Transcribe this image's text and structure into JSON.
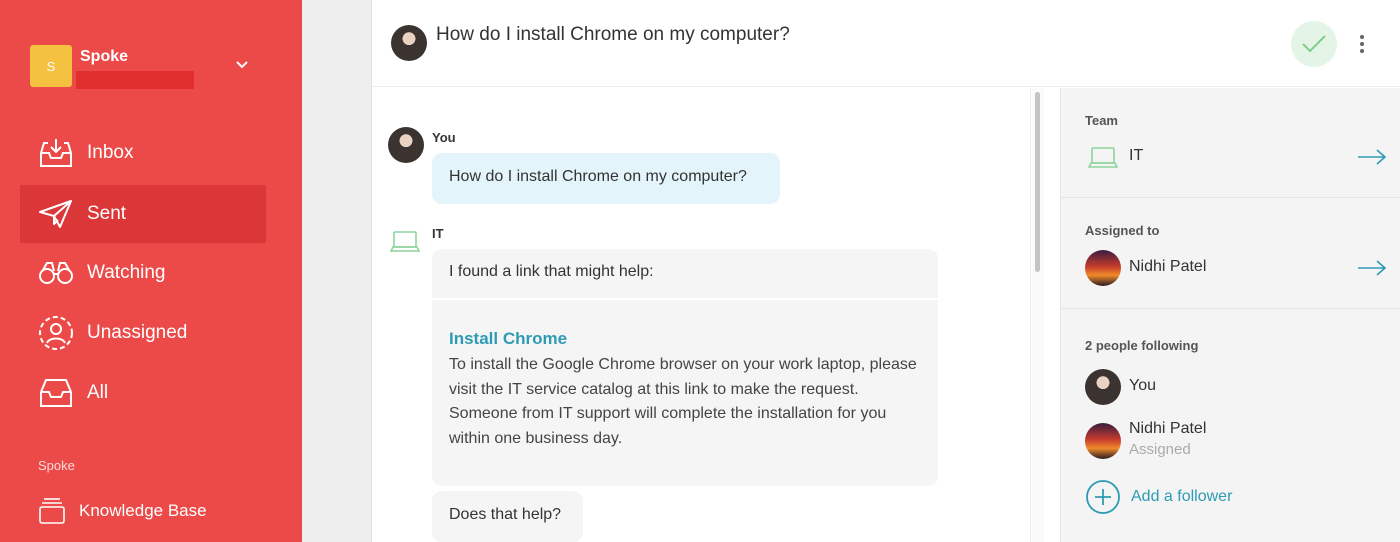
{
  "sidebar": {
    "workspace": {
      "logo_letter": "S",
      "name": "Spoke"
    },
    "nav": [
      {
        "label": "Inbox",
        "icon": "inbox-icon",
        "active": false
      },
      {
        "label": "Sent",
        "icon": "paper-plane-icon",
        "active": true
      },
      {
        "label": "Watching",
        "icon": "binoculars-icon",
        "active": false
      },
      {
        "label": "Unassigned",
        "icon": "unassigned-user-icon",
        "active": false
      },
      {
        "label": "All",
        "icon": "tray-icon",
        "active": false
      }
    ],
    "section_label": "Spoke",
    "knowledge_base_label": "Knowledge Base"
  },
  "header": {
    "title": "How do I install Chrome on my computer?"
  },
  "conversation": {
    "you": {
      "sender": "You",
      "text": "How do I install Chrome on my computer?"
    },
    "it": {
      "sender": "IT",
      "intro": "I found a link that might help:",
      "link_title": "Install Chrome",
      "link_description": "To install the Google Chrome browser on your work laptop, please visit the IT service catalog at this link to make the request. Someone from IT support will complete the installation for you within one business day.",
      "followup": "Does that help?"
    }
  },
  "details": {
    "team": {
      "label": "Team",
      "value": "IT"
    },
    "assigned": {
      "label": "Assigned to",
      "value": "Nidhi Patel"
    },
    "followers": {
      "label": "2 people following",
      "people": [
        {
          "name": "You",
          "sub": ""
        },
        {
          "name": "Nidhi Patel",
          "sub": "Assigned"
        }
      ],
      "add_label": "Add a follower"
    }
  },
  "colors": {
    "sidebar": "#eb4a49",
    "sidebar_active": "#dc3738",
    "workspace_logo": "#f5c140",
    "accent": "#2e9bb3",
    "resolve_bg": "#e4f5e7",
    "resolve_check": "#7ccf8a",
    "you_bubble": "#e3f5fa",
    "team_icon": "#8fd39c"
  }
}
